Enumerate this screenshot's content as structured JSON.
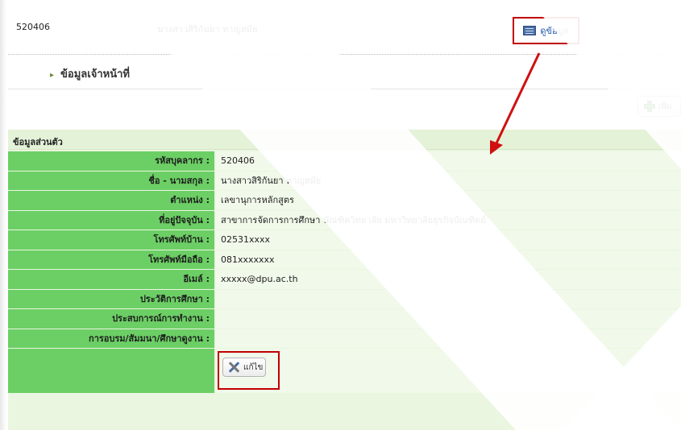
{
  "header": {
    "employee_id": "520406",
    "employee_name": "นางสาวสิริกันยา หาญสมัย",
    "view_button_label": "ดูข้อมูล"
  },
  "section": {
    "title": "ข้อมูลเจ้าหน้าที่",
    "add_button_label": "เพิ่ม"
  },
  "panel": {
    "title": "ข้อมูลส่วนตัว",
    "rows": [
      {
        "label": "รหัสบุคลากร :",
        "value": "520406"
      },
      {
        "label": "ชื่อ - นามสกุล :",
        "value": "นางสาวสิริกันยา หาญสมัย"
      },
      {
        "label": "ตำแหน่ง :",
        "value": "เลขานุการหลักสูตร"
      },
      {
        "label": "ที่อยู่ปัจจุบัน :",
        "value": "สาขาการจัดการการศึกษา บัณฑิตวิทยาลัย มหาวิทยาลัยธุรกิจบัณฑิตย์"
      },
      {
        "label": "โทรศัพท์บ้าน :",
        "value": "02531xxxx"
      },
      {
        "label": "โทรศัพท์มือถือ :",
        "value": "081xxxxxxx"
      },
      {
        "label": "อีเมล์ :",
        "value": "xxxxx@dpu.ac.th"
      },
      {
        "label": "ประวัติการศึกษา :",
        "value": ""
      },
      {
        "label": "ประสบการณ์การทำงาน :",
        "value": ""
      },
      {
        "label": "การอบรม/สัมมนา/ศึกษาดูงาน :",
        "value": ""
      }
    ],
    "edit_button_label": "แก้ไข"
  },
  "colors": {
    "label_green": "#6ccf65",
    "panel_bg": "#eaf6e0",
    "highlight_red": "#c00000",
    "arrow_red": "#d01010"
  },
  "icons": {
    "view": "document-view-icon",
    "add": "plus-icon",
    "edit": "tools-icon"
  }
}
